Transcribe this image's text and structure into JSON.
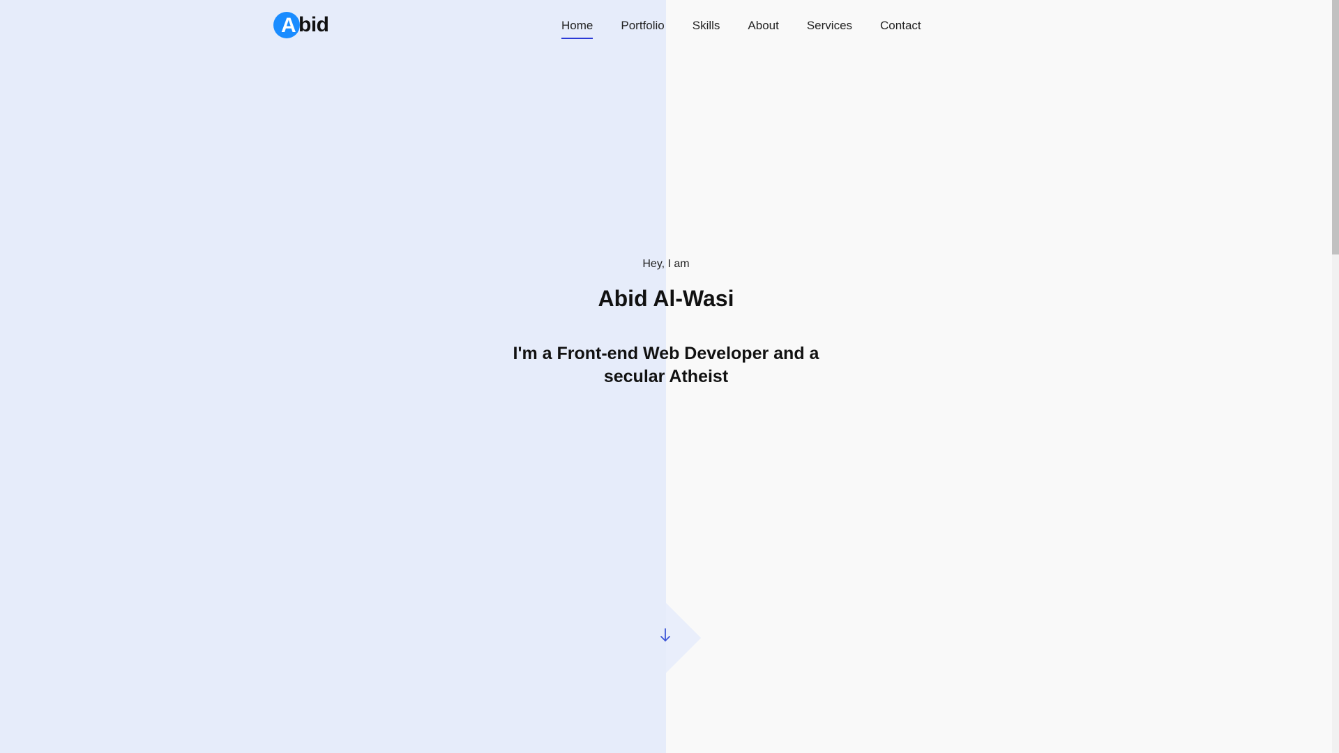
{
  "header": {
    "logo": {
      "first_letter": "A",
      "rest": "bid"
    },
    "nav": {
      "items": [
        {
          "label": "Home",
          "active": true
        },
        {
          "label": "Portfolio",
          "active": false
        },
        {
          "label": "Skills",
          "active": false
        },
        {
          "label": "About",
          "active": false
        },
        {
          "label": "Services",
          "active": false
        },
        {
          "label": "Contact",
          "active": false
        }
      ]
    }
  },
  "hero": {
    "greeting": "Hey, I am",
    "name": "Abid Al-Wasi",
    "tagline": "I'm a Front-end Web Developer and a secular Atheist"
  },
  "scroll_button": {
    "icon": "arrow-down-icon"
  },
  "colors": {
    "accent": "#1a8cff",
    "nav_underline": "#2b3ad6",
    "left_panel": "#e6ecfa",
    "right_panel": "#f9f9f9",
    "arrow": "#3c55d6"
  }
}
